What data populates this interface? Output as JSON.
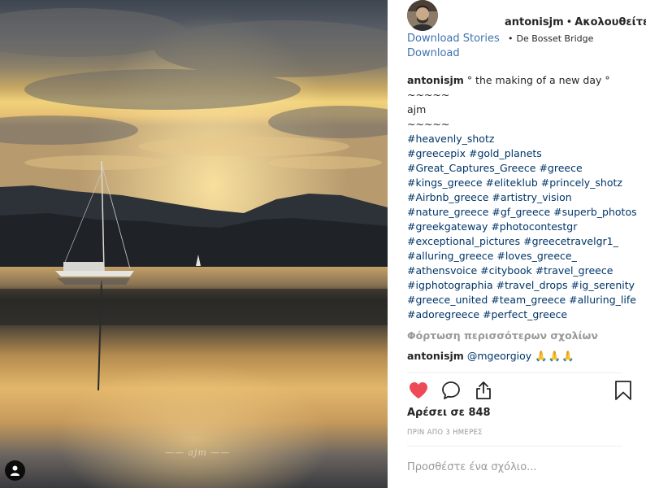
{
  "post": {
    "username": "antonisjm",
    "follow_status": "Ακολουθείτε",
    "location": "De Bosset Bridge",
    "photo_signature": "ajm"
  },
  "extension": {
    "download_stories": "Download Stories",
    "download": "Download"
  },
  "caption": {
    "username": "antonisjm",
    "first_line": "° the making of a new day °",
    "lines": [
      "~~~~~",
      "ajm",
      "~~~~~"
    ],
    "hashtag_lines": [
      "#heavenly_shotz",
      "#greecepix #gold_planets",
      "#Great_Captures_Greece #greece",
      "#kings_greece #eliteklub #princely_shotz",
      "#Airbnb_greece #artistry_vision",
      "#nature_greece #gf_greece #superb_photos",
      "#greekgateway #photocontestgr",
      "#exceptional_pictures #greecetravelgr1_",
      "#alluring_greece #loves_greece_",
      "#athensvoice #citybook #travel_greece",
      "#igphotographia #travel_drops #ig_serenity",
      "#greece_united #team_greece #alluring_life",
      "#adoregreece #perfect_greece"
    ]
  },
  "comments": {
    "load_more": "Φόρτωση περισσότερων σχολίων",
    "items": [
      {
        "username": "antonisjm",
        "mention": "@mgeorgioy",
        "emoji": "🙏🙏🙏"
      }
    ]
  },
  "stats": {
    "likes": "Αρέσει σε 848",
    "time": "ΠΡΙΝ ΑΠΟ 3 ΗΜΕΡΕΣ"
  },
  "add_comment": {
    "placeholder": "Προσθέστε ένα σχόλιο..."
  },
  "icons": {
    "like": "heart-filled-icon",
    "comment": "comment-bubble-icon",
    "share": "share-upload-icon",
    "save": "bookmark-icon",
    "user_tag": "person-icon"
  },
  "colors": {
    "link": "#003569",
    "extension_link": "#3f72af",
    "heart": "#ed4956",
    "muted": "#999999"
  }
}
